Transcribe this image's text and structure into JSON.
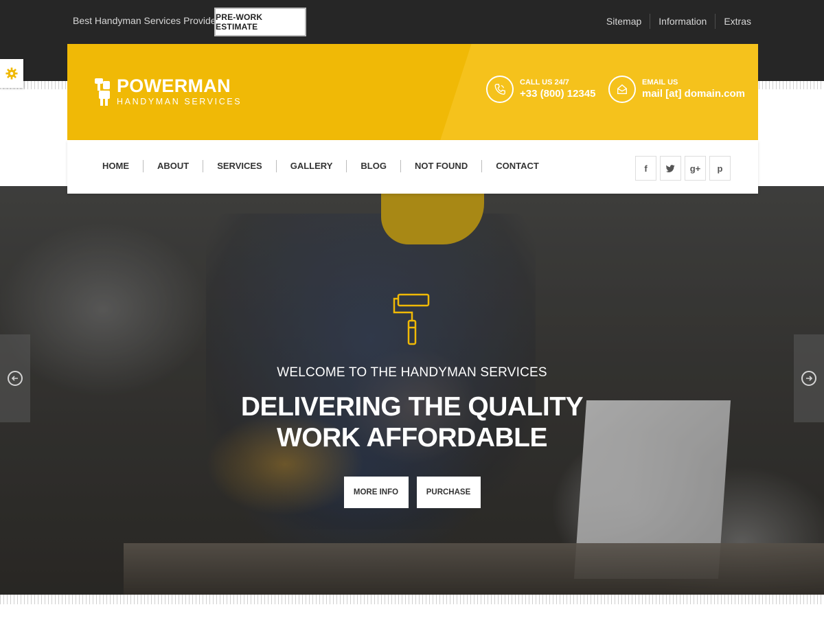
{
  "colors": {
    "accent": "#f0b906",
    "accent_light": "#f5c21c",
    "topbar": "#262626"
  },
  "topbar": {
    "tagline": "Best Handyman Services Provider !",
    "estimate_button": "PRE-WORK ESTIMATE",
    "links": [
      "Sitemap",
      "Information",
      "Extras"
    ]
  },
  "header": {
    "logo_title": "POWERMAN",
    "logo_subtitle": "HANDYMAN SERVICES",
    "phone_label": "CALL US 24/7",
    "phone_value": "+33 (800) 12345",
    "email_label": "EMAIL US",
    "email_value": "mail [at] domain.com"
  },
  "nav": {
    "items": [
      "HOME",
      "ABOUT",
      "SERVICES",
      "GALLERY",
      "BLOG",
      "NOT FOUND",
      "CONTACT"
    ],
    "social_icons": [
      "facebook-icon",
      "twitter-icon",
      "google-plus-icon",
      "pinterest-icon"
    ]
  },
  "hero": {
    "icon": "paint-roller-icon",
    "subtitle": "WELCOME TO THE HANDYMAN SERVICES",
    "title_line1": "DELIVERING THE QUALITY",
    "title_line2": "WORK AFFORDABLE",
    "button_more": "MORE INFO",
    "button_purchase": "PURCHASE"
  },
  "controls": {
    "settings_icon": "gear-icon",
    "prev_icon": "arrow-left-icon",
    "next_icon": "arrow-right-icon"
  }
}
